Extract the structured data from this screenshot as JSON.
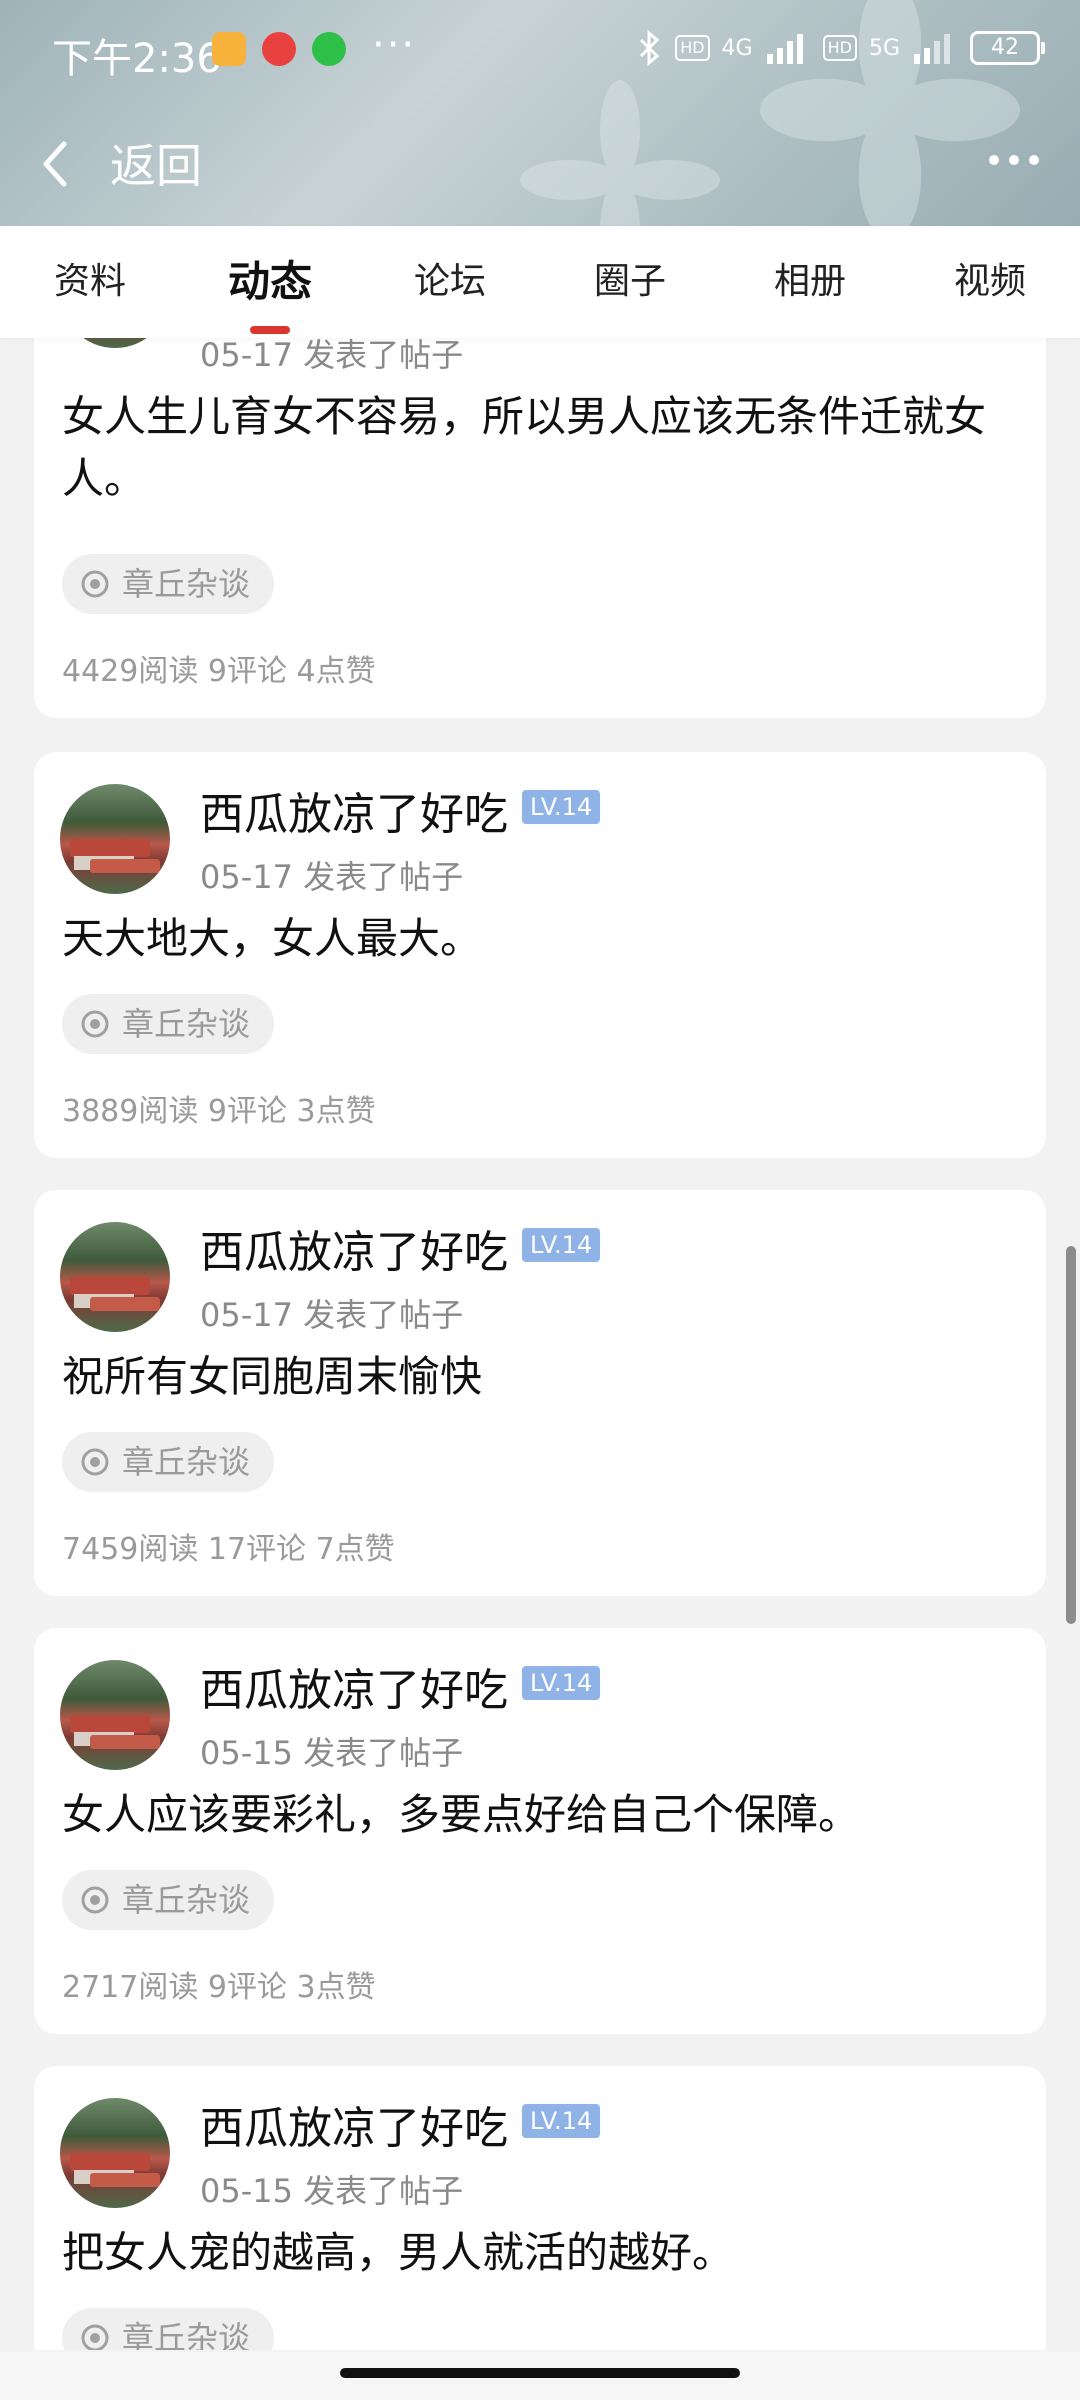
{
  "status_bar": {
    "time": "下午2:36",
    "network_a": "4G",
    "network_b": "5G",
    "hd": "HD",
    "battery": "42",
    "dots": "···",
    "icons": [
      "notification-icon",
      "shopping-app-icon",
      "wechat-icon",
      "bluetooth-icon",
      "signal-icon"
    ]
  },
  "nav": {
    "back_label": "返回"
  },
  "tabs": [
    {
      "label": "资料",
      "active": false
    },
    {
      "label": "动态",
      "active": true
    },
    {
      "label": "论坛",
      "active": false
    },
    {
      "label": "圈子",
      "active": false
    },
    {
      "label": "相册",
      "active": false
    },
    {
      "label": "视频",
      "active": false
    }
  ],
  "posts": [
    {
      "username": "",
      "level": "",
      "meta": "05-17 发表了帖子",
      "content": "女人生儿育女不容易，所以男人应该无条件迁就女人。",
      "tag": "章丘杂谈",
      "stats": "4429阅读 9评论 4点赞"
    },
    {
      "username": "西瓜放凉了好吃",
      "level": "LV.14",
      "meta": "05-17 发表了帖子",
      "content": "天大地大，女人最大。",
      "tag": "章丘杂谈",
      "stats": "3889阅读 9评论 3点赞"
    },
    {
      "username": "西瓜放凉了好吃",
      "level": "LV.14",
      "meta": "05-17 发表了帖子",
      "content": "祝所有女同胞周末愉快",
      "tag": "章丘杂谈",
      "stats": "7459阅读 17评论 7点赞"
    },
    {
      "username": "西瓜放凉了好吃",
      "level": "LV.14",
      "meta": "05-15 发表了帖子",
      "content": "女人应该要彩礼，多要点好给自己个保障。",
      "tag": "章丘杂谈",
      "stats": "2717阅读 9评论 3点赞"
    },
    {
      "username": "西瓜放凉了好吃",
      "level": "LV.14",
      "meta": "05-15 发表了帖子",
      "content": "把女人宠的越高，男人就活的越好。",
      "tag": "章丘杂谈",
      "stats": ""
    }
  ]
}
